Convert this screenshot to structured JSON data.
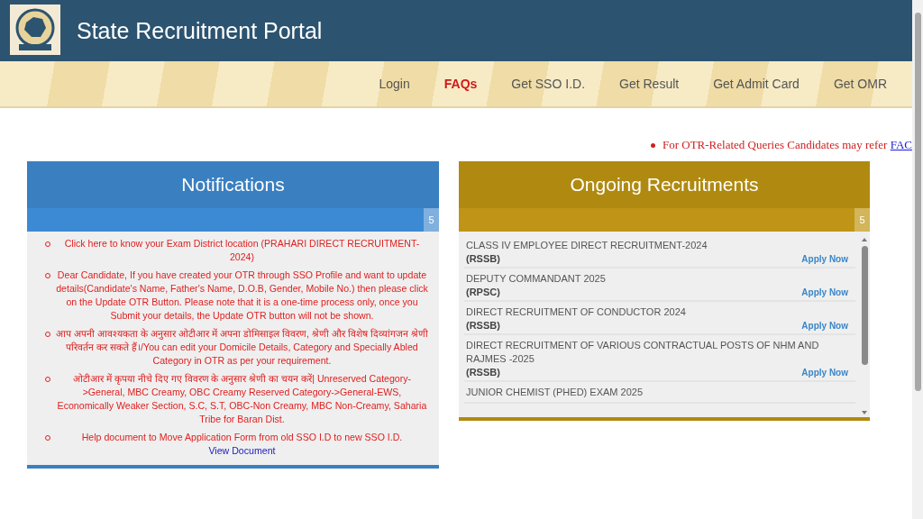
{
  "header": {
    "title": "State Recruitment Portal"
  },
  "nav": [
    {
      "label": "Login",
      "selected": false
    },
    {
      "label": "FAQs",
      "selected": true
    },
    {
      "label": "Get SSO I.D.",
      "selected": false
    },
    {
      "label": "Get Result",
      "selected": false
    },
    {
      "label": "Get Admit Card",
      "selected": false
    },
    {
      "label": "Get OMR",
      "selected": false
    }
  ],
  "notice": {
    "text": "For OTR-Related Queries Candidates may refer",
    "link": "FAC"
  },
  "notifications": {
    "title": "Notifications",
    "count": "5",
    "items": [
      {
        "text": "Click here to know your Exam District location (PRAHARI DIRECT RECRUITMENT-2024)"
      },
      {
        "text": "Dear Candidate, If you have created your OTR through SSO Profile and want to update details(Candidate's Name, Father's Name, D.O.B, Gender, Mobile No.) then please click on the Update OTR Button. Please note that it is a one-time process only, once you Submit your details, the Update OTR button will not be shown."
      },
      {
        "text": "आप अपनी आवश्यकता के अनुसार ओटीआर में अपना डोमिसाइल विवरण, श्रेणी और विशेष दिव्यांगजन श्रेणी परिवर्तन कर सकते हैं।/You can edit your Domicile Details, Category and Specially Abled Category in OTR as per your requirement."
      },
      {
        "text": "ओटीआर में कृपया नीचे दिए गए विवरण के अनुसार श्रेणी का चयन करें| Unreserved Category->General, MBC Creamy, OBC Creamy Reserved Category->General-EWS, Economically Weaker Section, S.C, S.T, OBC-Non Creamy, MBC Non-Creamy, Saharia Tribe for Baran Dist."
      },
      {
        "text": "Help document to Move Application Form from old SSO I.D to new SSO I.D.",
        "link": "View Document"
      }
    ]
  },
  "recruitments": {
    "title": "Ongoing Recruitments",
    "count": "5",
    "items": [
      {
        "title": "CLASS IV EMPLOYEE DIRECT RECRUITMENT-2024",
        "org": "(RSSB)",
        "action": "Apply Now"
      },
      {
        "title": "DEPUTY COMMANDANT 2025",
        "org": "(RPSC)",
        "action": "Apply Now"
      },
      {
        "title": "DIRECT RECRUITMENT OF CONDUCTOR 2024",
        "org": "(RSSB)",
        "action": "Apply Now"
      },
      {
        "title": "DIRECT RECRUITMENT OF VARIOUS CONTRACTUAL POSTS OF NHM AND RAJMES -2025",
        "org": "(RSSB)",
        "action": "Apply Now"
      },
      {
        "title": "JUNIOR CHEMIST (PHED) EXAM 2025"
      }
    ]
  }
}
